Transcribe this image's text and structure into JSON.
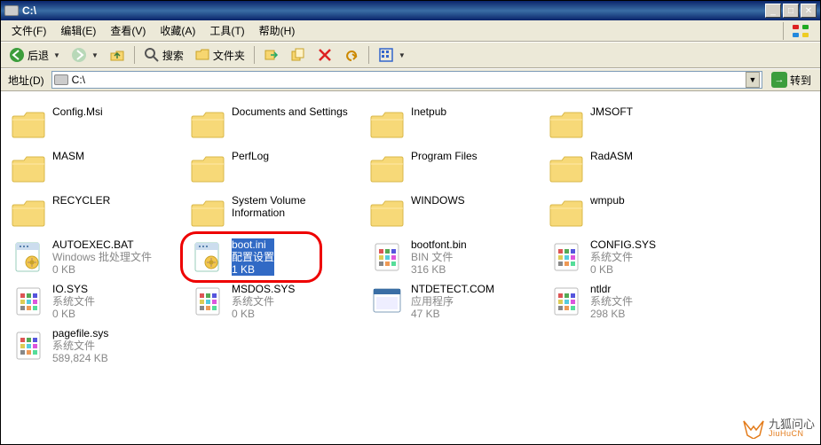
{
  "window": {
    "title": "C:\\"
  },
  "menu": {
    "file": "文件(F)",
    "edit": "编辑(E)",
    "view": "查看(V)",
    "fav": "收藏(A)",
    "tools": "工具(T)",
    "help": "帮助(H)"
  },
  "toolbar": {
    "back": "后退",
    "search": "搜索",
    "folders": "文件夹"
  },
  "address": {
    "label": "地址(D)",
    "path": "C:\\",
    "go": "转到"
  },
  "items": [
    {
      "type": "folder",
      "name": "Config.Msi"
    },
    {
      "type": "folder",
      "name": "Documents and Settings"
    },
    {
      "type": "folder",
      "name": "Inetpub"
    },
    {
      "type": "folder",
      "name": "JMSOFT"
    },
    {
      "type": "folder",
      "name": "MASM"
    },
    {
      "type": "folder",
      "name": "PerfLog"
    },
    {
      "type": "folder",
      "name": "Program Files"
    },
    {
      "type": "folder",
      "name": "RadASM"
    },
    {
      "type": "folder",
      "name": "RECYCLER"
    },
    {
      "type": "folder",
      "name": "System Volume Information"
    },
    {
      "type": "folder",
      "name": "WINDOWS"
    },
    {
      "type": "folder",
      "name": "wmpub"
    },
    {
      "type": "bat",
      "name": "AUTOEXEC.BAT",
      "l2": "Windows 批处理文件",
      "l3": "0 KB"
    },
    {
      "type": "ini",
      "name": "boot.ini",
      "l2": "配置设置",
      "l3": "1 KB",
      "selected": true,
      "ring": true
    },
    {
      "type": "bin",
      "name": "bootfont.bin",
      "l2": "BIN 文件",
      "l3": "316 KB"
    },
    {
      "type": "sys",
      "name": "CONFIG.SYS",
      "l2": "系统文件",
      "l3": "0 KB"
    },
    {
      "type": "sys",
      "name": "IO.SYS",
      "l2": "系统文件",
      "l3": "0 KB"
    },
    {
      "type": "sys",
      "name": "MSDOS.SYS",
      "l2": "系统文件",
      "l3": "0 KB"
    },
    {
      "type": "app",
      "name": "NTDETECT.COM",
      "l2": "应用程序",
      "l3": "47 KB"
    },
    {
      "type": "sys",
      "name": "ntldr",
      "l2": "系统文件",
      "l3": "298 KB"
    },
    {
      "type": "sys",
      "name": "pagefile.sys",
      "l2": "系统文件",
      "l3": "589,824 KB"
    }
  ],
  "watermark": {
    "cn": "九狐问心",
    "en": "JiuHuCN"
  }
}
